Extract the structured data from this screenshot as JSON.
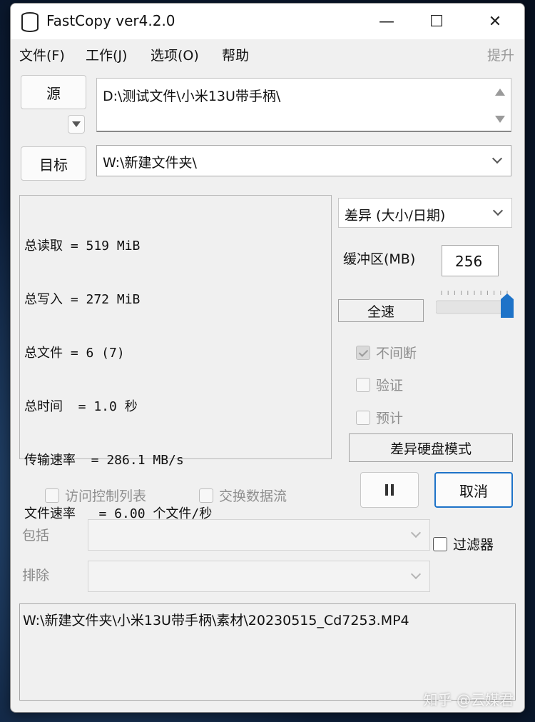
{
  "window": {
    "title": "FastCopy ver4.2.0",
    "minimize": "—",
    "maximize": "☐",
    "close": "✕"
  },
  "menu": {
    "file": "文件(F)",
    "job": "工作(J)",
    "options": "选项(O)",
    "help": "帮助",
    "raise": "提升"
  },
  "source": {
    "button": "源",
    "path": "D:\\测试文件\\小米13U带手柄\\"
  },
  "dest": {
    "button": "目标",
    "path": "W:\\新建文件夹\\"
  },
  "stats": {
    "lines": [
      "总读取 = 519 MiB",
      "总写入 = 272 MiB",
      "总文件 = 6 (7)",
      "总时间  = 1.0 秒",
      "传输速率  = 286.1 MB/s",
      "文件速率   = 6.00 个文件/秒"
    ]
  },
  "mode": {
    "selected": "差异 (大小/日期)"
  },
  "buffer": {
    "label": "缓冲区(MB)",
    "value": "256",
    "speed_label": "全速",
    "speed_level": 1.0
  },
  "options": {
    "nonstop": {
      "label": "不间断",
      "checked": true
    },
    "verify": {
      "label": "验证",
      "checked": false
    },
    "estimate": {
      "label": "预计",
      "checked": false
    },
    "diff_disk_mode": "差异硬盘模式",
    "acl": {
      "label": "访问控制列表",
      "checked": false
    },
    "streams": {
      "label": "交换数据流",
      "checked": false
    }
  },
  "actions": {
    "pause_icon": "pause-icon",
    "cancel": "取消"
  },
  "filter": {
    "include_label": "包括",
    "exclude_label": "排除",
    "filter_label": "过滤器",
    "include_value": "",
    "exclude_value": ""
  },
  "status": {
    "current_file": "W:\\新建文件夹\\小米13U带手柄\\素材\\20230515_Cd7253.MP4"
  },
  "watermark": "知乎 @云媒君"
}
